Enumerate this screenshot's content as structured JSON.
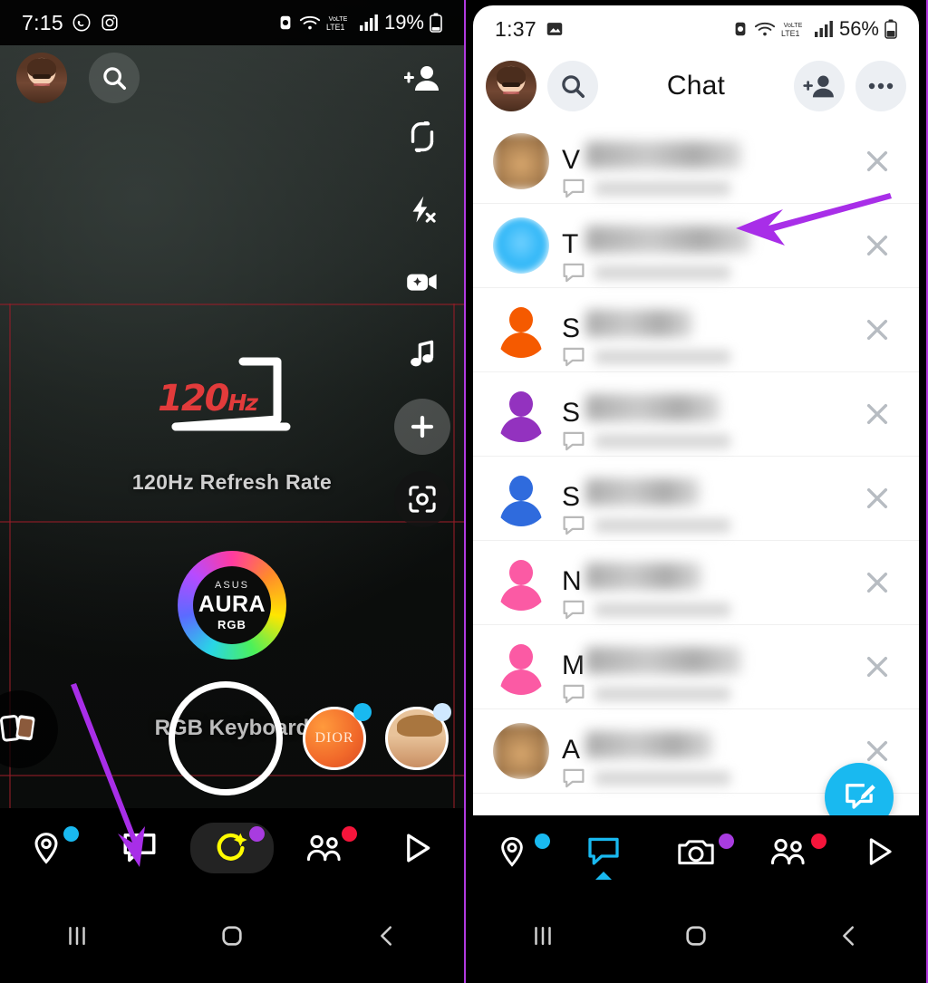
{
  "left_phone": {
    "status_bar": {
      "time": "7:15",
      "battery_percent": "19%",
      "network_label": "LTE1",
      "volte_label": "VoLTE",
      "icons": [
        "whatsapp-icon",
        "instagram-icon",
        "alarm-icon",
        "wifi-icon",
        "volte-icon",
        "signal-icon",
        "battery-icon"
      ]
    },
    "camera_top_bar": {
      "profile_label": "Bitmoji avatar",
      "search_label": "Search",
      "add_friend_label": "Add Friend",
      "flip_camera_label": "Flip Camera"
    },
    "camera_rail": [
      {
        "name": "flip-camera-icon",
        "label": "Flip Camera"
      },
      {
        "name": "flash-off-icon",
        "label": "Flash Off"
      },
      {
        "name": "night-camera-icon",
        "label": "Night Mode"
      },
      {
        "name": "music-icon",
        "label": "Sounds"
      },
      {
        "name": "add-lens-icon",
        "label": "Add"
      },
      {
        "name": "scan-icon",
        "label": "Scan"
      }
    ],
    "scene": {
      "hz_text": "120",
      "hz_unit": "Hz",
      "refresh_caption": "120Hz Refresh Rate",
      "aura_brand": "ASUS",
      "aura_title": "AURA",
      "aura_sub": "RGB",
      "keyboard_caption": "RGB Keyboard"
    },
    "lens_row": {
      "memories_label": "Memories",
      "shutter_label": "Capture",
      "lenses": [
        {
          "name": "lens-dior",
          "label": "DIOR"
        },
        {
          "name": "lens-character",
          "label": "Character Lens"
        }
      ]
    },
    "bottom_nav": [
      {
        "name": "map-tab",
        "label": "Map",
        "active": false,
        "badge": ""
      },
      {
        "name": "chat-tab",
        "label": "Chat",
        "active": false,
        "badge": "#19b9f0"
      },
      {
        "name": "camera-tab",
        "label": "Camera",
        "active": true,
        "badge": ""
      },
      {
        "name": "stories-tab",
        "label": "Stories",
        "active": false,
        "badge": "#a83ce0"
      },
      {
        "name": "spotlight-tab",
        "label": "Spotlight",
        "active": false,
        "badge": "#f5153b"
      }
    ],
    "system_nav": [
      "recents-button",
      "home-button",
      "back-button"
    ],
    "annotation": {
      "arrow_color": "#a82ee8",
      "points_to": "chat-tab"
    }
  },
  "right_phone": {
    "status_bar": {
      "time": "1:37",
      "battery_percent": "56%",
      "network_label": "LTE1",
      "volte_label": "VoLTE",
      "icons": [
        "screenshot-icon",
        "alarm-icon",
        "wifi-icon",
        "volte-icon",
        "signal-icon",
        "battery-icon"
      ]
    },
    "header": {
      "title": "Chat",
      "profile_label": "Bitmoji avatar",
      "search_label": "Search",
      "add_friend_label": "Add Friend",
      "more_label": "More options"
    },
    "chat_rows": [
      {
        "initial": "V",
        "avatar_type": "photo",
        "avatar_color": "#b99267",
        "name_width": 172,
        "close_label": "Clear conversation"
      },
      {
        "initial": "T",
        "avatar_type": "blue",
        "avatar_color": "#35bdf8",
        "name_width": 182,
        "close_label": "Clear conversation"
      },
      {
        "initial": "S",
        "avatar_type": "person",
        "avatar_color": "#f55a00",
        "name_width": 118,
        "close_label": "Clear conversation"
      },
      {
        "initial": "S",
        "avatar_type": "person",
        "avatar_color": "#9332bf",
        "name_width": 148,
        "close_label": "Clear conversation"
      },
      {
        "initial": "S",
        "avatar_type": "person",
        "avatar_color": "#2f6bdd",
        "name_width": 126,
        "close_label": "Clear conversation"
      },
      {
        "initial": "N",
        "avatar_type": "person",
        "avatar_color": "#fb5aa4",
        "name_width": 128,
        "close_label": "Clear conversation"
      },
      {
        "initial": "M",
        "avatar_type": "person",
        "avatar_color": "#fb5aa4",
        "name_width": 172,
        "close_label": "Clear conversation"
      },
      {
        "initial": "A",
        "avatar_type": "photo",
        "avatar_color": "#c29a6a",
        "name_width": 140,
        "close_label": "Clear conversation"
      }
    ],
    "fab": {
      "name": "new-chat-button",
      "label": "New Chat",
      "color": "#19b9f0"
    },
    "bottom_nav": [
      {
        "name": "map-tab",
        "label": "Map",
        "active": false,
        "badge": ""
      },
      {
        "name": "chat-tab",
        "label": "Chat",
        "active": true,
        "badge": "#19b9f0"
      },
      {
        "name": "camera-tab",
        "label": "Camera",
        "active": false,
        "badge": ""
      },
      {
        "name": "stories-tab",
        "label": "Stories",
        "active": false,
        "badge": "#a83ce0"
      },
      {
        "name": "spotlight-tab",
        "label": "Spotlight",
        "active": false,
        "badge": "#f5153b"
      }
    ],
    "system_nav": [
      "recents-button",
      "home-button",
      "back-button"
    ],
    "annotation": {
      "arrow_color": "#a82ee8",
      "points_to": "chat-row-2"
    }
  },
  "colors": {
    "accent_blue": "#19b9f0",
    "accent_purple": "#a82ee8",
    "accent_red": "#f5153b",
    "snap_yellow": "#fffc00",
    "panel_border": "#b13ae0"
  }
}
